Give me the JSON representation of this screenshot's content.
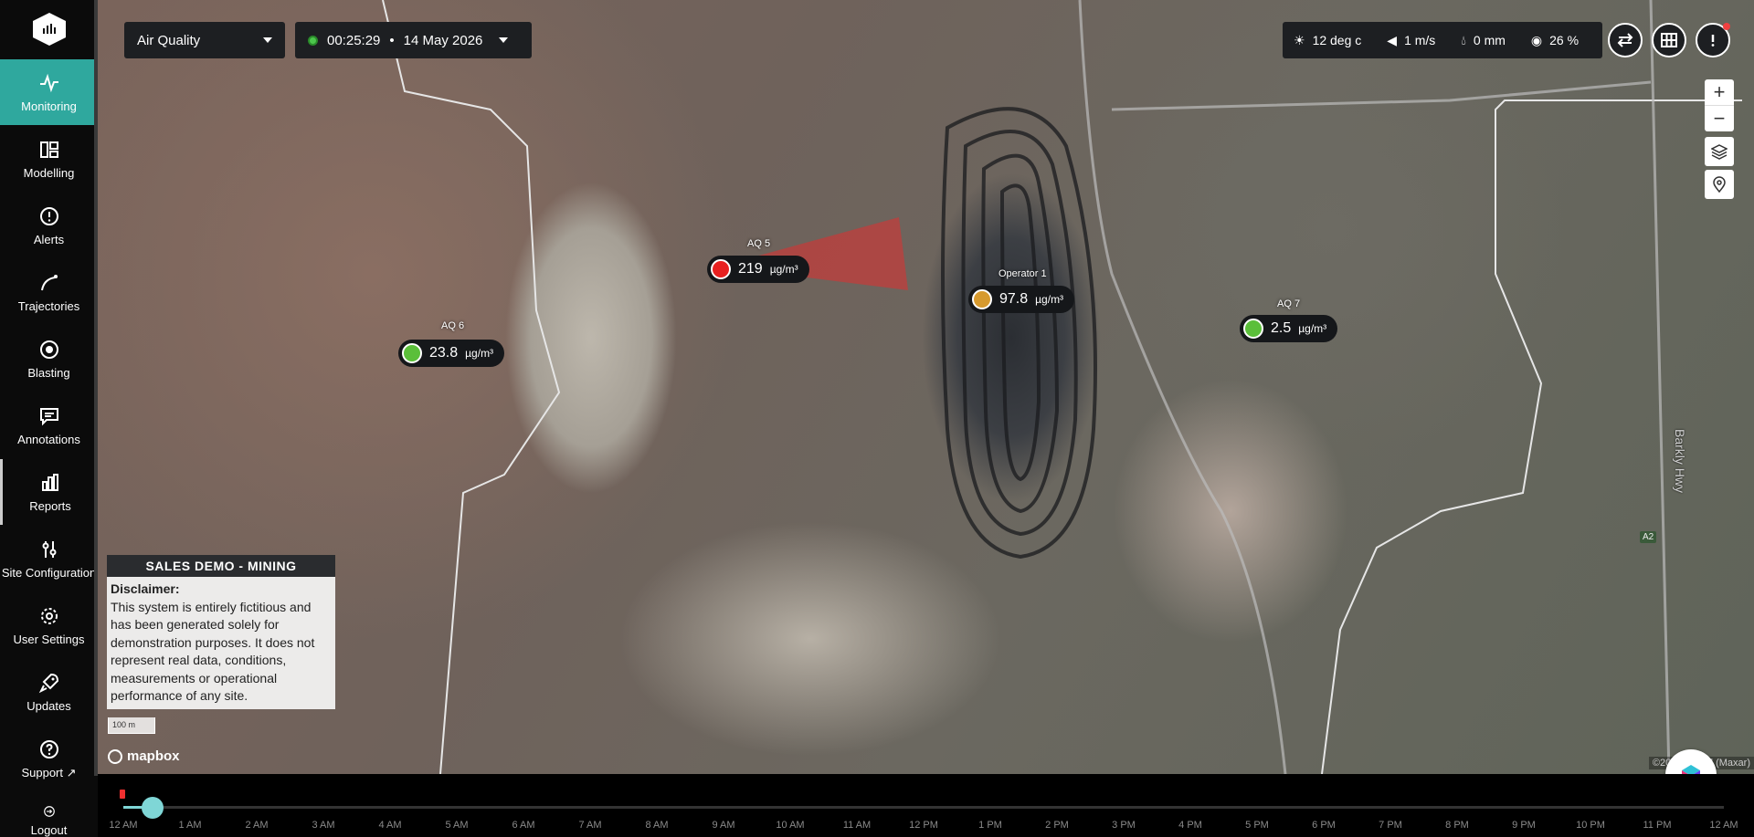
{
  "sidebar": {
    "items": [
      {
        "label": "Monitoring",
        "icon": "monitoring-pulse-icon",
        "active": true
      },
      {
        "label": "Modelling",
        "icon": "modelling-icon"
      },
      {
        "label": "Alerts",
        "icon": "alert-circle-icon"
      },
      {
        "label": "Trajectories",
        "icon": "trajectory-icon"
      },
      {
        "label": "Blasting",
        "icon": "blasting-target-icon"
      },
      {
        "label": "Annotations",
        "icon": "annotation-chat-icon"
      },
      {
        "label": "Reports",
        "icon": "bar-chart-icon"
      },
      {
        "label": "Site Configuration",
        "icon": "sliders-icon"
      },
      {
        "label": "User Settings",
        "icon": "gear-icon"
      },
      {
        "label": "Updates",
        "icon": "rocket-icon"
      },
      {
        "label": "Support",
        "icon": "question-circle-icon"
      },
      {
        "label": "Logout",
        "icon": "logout-icon"
      }
    ]
  },
  "toolbar": {
    "layer": "Air Quality",
    "time": "00:25:29",
    "separator": "•",
    "date": "14 May 2026"
  },
  "weather": {
    "temperature": "12 deg c",
    "wind": "1 m/s",
    "rain": "0 mm",
    "humidity": "26 %"
  },
  "sensors": [
    {
      "name": "AQ 5",
      "value": "219",
      "unit": "µg/m³",
      "status_color": "#e82020"
    },
    {
      "name": "Operator 1",
      "value": "97.8",
      "unit": "µg/m³",
      "status_color": "#d79a2e"
    },
    {
      "name": "AQ 7",
      "value": "2.5",
      "unit": "µg/m³",
      "status_color": "#5bbf3a"
    },
    {
      "name": "AQ 6",
      "value": "23.8",
      "unit": "µg/m³",
      "status_color": "#5bbf3a"
    }
  ],
  "disclaimer": {
    "title": "SALES DEMO - MINING",
    "heading": "Disclaimer:",
    "text": "This system is entirely fictitious and has been generated solely for demonstration purposes. It does not represent real data, conditions, measurements or operational performance of any site."
  },
  "map": {
    "scale": "100 m",
    "attribution": "©2026 Digital (Maxar)",
    "brand": "mapbox",
    "road_label": "Barkly Hwy",
    "road_shield": "A2"
  },
  "timeline": {
    "labels": [
      "12 AM",
      "1 AM",
      "2 AM",
      "3 AM",
      "4 AM",
      "5 AM",
      "6 AM",
      "7 AM",
      "8 AM",
      "9 AM",
      "10 AM",
      "11 AM",
      "12 PM",
      "1 PM",
      "2 PM",
      "3 PM",
      "4 PM",
      "5 PM",
      "6 PM",
      "7 PM",
      "8 PM",
      "9 PM",
      "10 PM",
      "11 PM",
      "12 AM"
    ],
    "progress": 0.018
  }
}
